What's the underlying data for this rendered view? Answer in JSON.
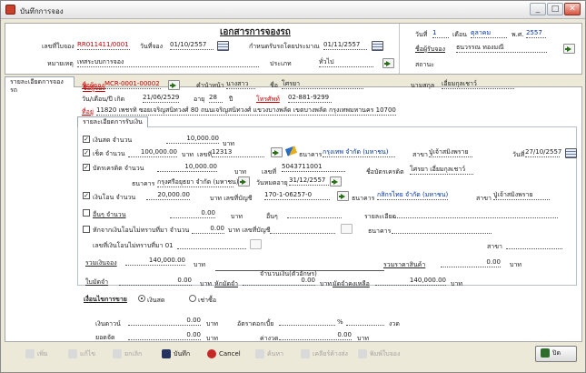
{
  "window": {
    "title": "บันทึกการจอง",
    "min": "_",
    "max": "□",
    "close": "✕"
  },
  "doc": {
    "title": "เอกสารการจองรถ"
  },
  "hdr": {
    "doc_no_label": "เลขที่ใบจอง",
    "doc_no": "RR011411/0001",
    "book_date_label": "วันที่จอง",
    "book_date": "01/10/2557",
    "deliv_date_label": "กำหนดรับรถโดยประมาณ",
    "deliv_date": "01/11/2557",
    "note_label": "หมายเหตุ",
    "note": "เทสระบบการจอง",
    "type_label": "ประเภท",
    "type": "ทั่วไป",
    "day_label": "วันที่",
    "day": "1",
    "month_label": "เดือน",
    "month": "ตุลาคม",
    "year_label": "พ.ศ.",
    "year": "2557",
    "sales_label": "ชื่อผู้รับจอง",
    "sales": "ธนวรรณ ทองมณี",
    "status_label": "สถานะ"
  },
  "tabs": {
    "main": "รายละเอียดการจองรถ",
    "sub": "รายละเอียดการรับเงิน"
  },
  "cust": {
    "name_label": "ชื่อผู้จอง",
    "code": "MCR-0001-00002",
    "prefix_label": "คำนำหน้า",
    "prefix": "นางสาว",
    "first_label": "ชื่อ",
    "first": "โศรยา",
    "last_label": "นามสกุล",
    "last": "เอี่ยมกุลเชาว์",
    "dob_label": "วัน/เดือน/ปี เกิด",
    "dob": "21/06/2529",
    "age_label": "อายุ",
    "age": "28",
    "age_unit": "ปี",
    "phone_label": "โทรศัพท์",
    "phone": "02-881-9299",
    "addr_label": "ที่อยู่",
    "addr": "11820 เพชรทิ ซอยเจริญสนิทวงศ์ 80 ถนนเจริญสนิทวงศ์ แขวงบางพลัด เขตบางพลัด กรุงเทพมหานคร 10700"
  },
  "pay": {
    "cash_label": "เงินสด จำนวน",
    "cash": "10,000.00",
    "baht": "บาท",
    "cheque_label": "เช็ค จำนวน",
    "cheque": "100,000.00",
    "no_label": "เลขที่",
    "cheque_no": "12313",
    "bank_label": "ธนาคาร",
    "cheque_bank": "กรุงเทพ จำกัด (มหาชน)",
    "branch_label": "สาขา",
    "cheque_branch": "ปู่เจ้าสมิงพราย",
    "date_label": "วันที่",
    "cheque_date": "27/10/2557",
    "card_label": "บัตรเครดิต จำนวน",
    "card": "10,000.00",
    "card_no": "5043711001",
    "holder_label": "ชื่อบัตรเครดิต",
    "holder": "โศรยา เอี่ยมกุลเชาว์",
    "card_bank": "กรุงศรีอยุธยา จำกัด (มหาชน)",
    "expire_label": "วันหมดอายุ",
    "expire": "31/12/2557",
    "transfer_label": "เงินโอน จำนวน",
    "transfer": "20,000.00",
    "acc_label": "บาท เลขที่บัญชี",
    "transfer_acc": "170-1-06257-0",
    "transfer_bank": "กสิกรไทย จำกัด (มหาชน)",
    "transfer_branch": "ปู่เจ้าสมิงพราย",
    "other_label": "อื่นๆ จำนวน",
    "other": "0.00",
    "other2_label": "อื่นๆ",
    "detail_label": "รายละเอียด",
    "wht_label": "หักจากเงินโอนไม่ทราบที่มา จำนวน",
    "wht": "0.00",
    "wht_acc_label": "บาท เลขที่บัญชี",
    "unk_label": "เลขที่เงินโอนไม่ทราบที่มา 01",
    "unk_branch_label": "สาขา",
    "total_label": "รวมเงินจอง",
    "total": "140,000.00",
    "price_label": "รวมราคาสินค้า",
    "price": "0.00",
    "words_label": "จำนวนเงิน(ตัวอักษร)",
    "down_label": "ใบมัดจำ",
    "down": "0.00",
    "paid_label": "หักมัดจำ",
    "paid": "0.00",
    "remain_label": "มัดจำคงเหลือ",
    "remain": "140,000.00"
  },
  "cond": {
    "label": "เงื่อนไขการขาย",
    "cash_label": "เงินสด",
    "lease_label": "เช่าซื้อ",
    "down_label": "เงินดาวน์",
    "down": "0.00",
    "rate_label": "อัตราดอกเบี้ย",
    "pct": "%",
    "term_label": "งวด",
    "bal_label": "ยอดจัด",
    "bal": "0.00",
    "inst_label": "ค่างวด",
    "inst": "0.00"
  },
  "toolbar": {
    "add": "เพิ่ม",
    "edit": "แก้ไข",
    "cancel_th": "ยกเลิก",
    "save": "บันทึก",
    "cancel": "Cancel",
    "search": "ค้นหา",
    "clear": "เคลียร์ค้างส่ง",
    "print": "พิมพ์ใบจอง",
    "close": "ปิด"
  },
  "colors": {
    "red": "#c00000",
    "blue": "#003399",
    "bg": "#ece9d8"
  }
}
